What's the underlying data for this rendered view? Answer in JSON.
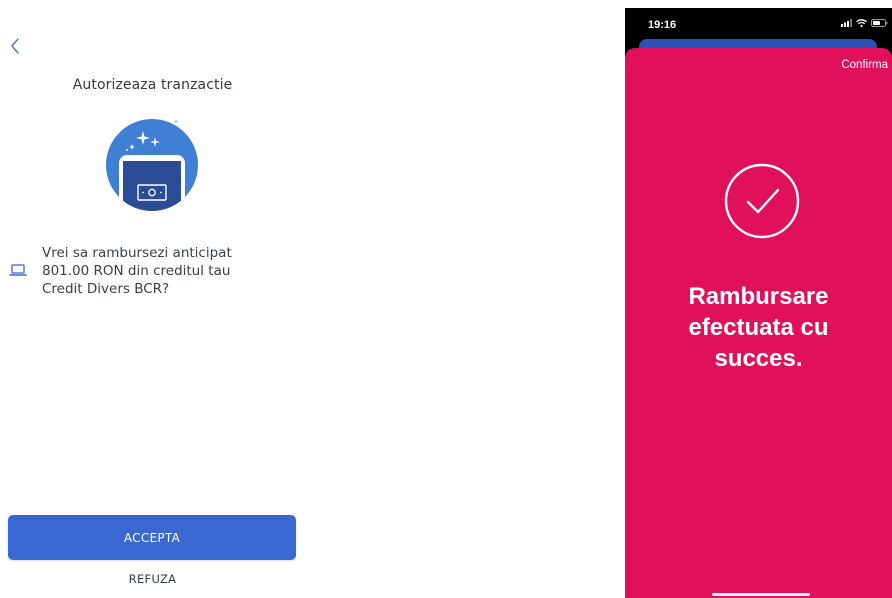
{
  "left_screen": {
    "title": "Autorizeaza tranzactie",
    "back_icon": "chevron-left-icon",
    "illustration_icon": "phone-cash-icon",
    "message_icon": "laptop-icon",
    "message_lines": [
      "Vrei sa rambursezi anticipat",
      "801.00 RON din creditul tau",
      "Credit Divers BCR?"
    ],
    "accept_label": "ACCEPTA",
    "refuse_label": "REFUZA"
  },
  "right_screen": {
    "status_time": "19:16",
    "status_icons": [
      "signal-icon",
      "wifi-icon",
      "battery-icon"
    ],
    "confirm_label": "Confirma",
    "success_icon": "checkmark-circle-icon",
    "success_lines": [
      "Rambursare",
      "efectuata cu",
      "succes."
    ]
  },
  "colors": {
    "primary_blue": "#3a68d3",
    "illustration_blue": "#3f7fd4",
    "success_pink": "#e0115a",
    "text_dark": "#333a44"
  }
}
